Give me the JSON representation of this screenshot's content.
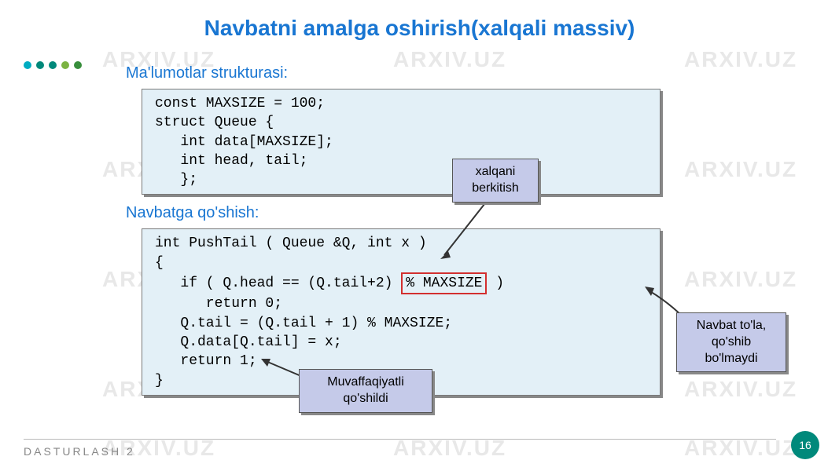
{
  "title": "Navbatni amalga oshirish(xalqali massiv)",
  "subtitle1": "Ma'lumotlar strukturasi:",
  "subtitle2": "Navbatga qo'shish:",
  "code_block_1": {
    "l1": "const MAXSIZE = 100;",
    "l2": "struct Queue {",
    "l3": "   int data[MAXSIZE];",
    "l4": "   int head, tail;",
    "l5": "   };"
  },
  "code_block_2": {
    "l1": "int PushTail ( Queue &Q, int x )",
    "l2": "{",
    "l3a": "   if ( Q.head == (Q.tail+2) ",
    "l3b": "% MAXSIZE",
    "l3c": " )",
    "l4": "      return 0;",
    "l5": "   Q.tail = (Q.tail + 1) % MAXSIZE;",
    "l6": "   Q.data[Q.tail] = x;",
    "l7": "   return 1;",
    "l8": "}"
  },
  "callouts": {
    "c1_l1": "xalqani",
    "c1_l2": "berkitish",
    "c2_l1": "Navbat to'la,",
    "c2_l2": "qo'shib",
    "c2_l3": "bo'lmaydi",
    "c3_l1": "Muvaffaqiyatli",
    "c3_l2": "qo'shildi"
  },
  "footer": "DASTURLASH 2",
  "page": "16",
  "watermark": "ARXIV.UZ"
}
